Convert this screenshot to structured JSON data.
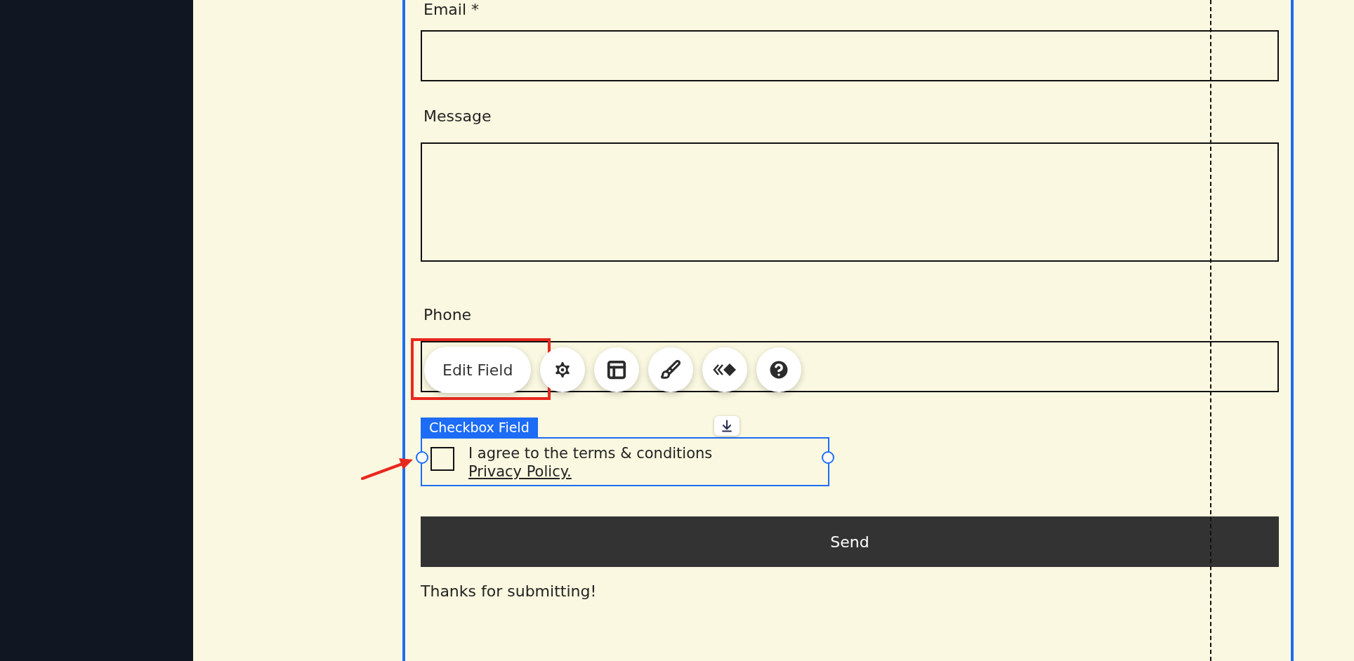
{
  "form": {
    "fields": [
      {
        "label": "Email *",
        "kind": "input"
      },
      {
        "label": "Message",
        "kind": "textarea"
      },
      {
        "label": "Phone",
        "kind": "input"
      }
    ]
  },
  "toolbar": {
    "button": "Edit Field"
  },
  "checkbox": {
    "tag": "Checkbox Field",
    "text": "I agree to the terms & conditions",
    "link": "Privacy Policy.",
    "checked": false
  },
  "submit": "Send",
  "success": "Thanks for submitting!"
}
